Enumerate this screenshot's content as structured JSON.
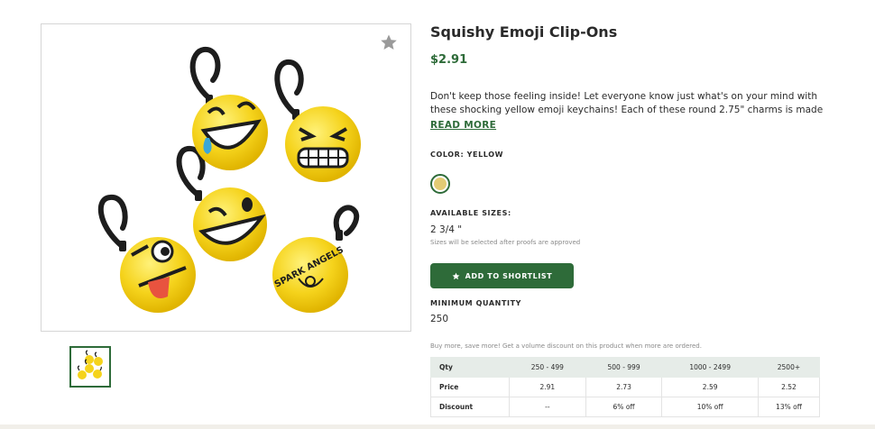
{
  "product": {
    "title": "Squishy Emoji Clip-Ons",
    "price": "$2.91",
    "description": "Don't keep those feeling inside! Let everyone know just what's on your mind with these shocking yellow emoji keychains! Each of these round 2.75\" charms is made o...",
    "read_more": "READ MORE",
    "imprint_text": "SPARK ANGELS"
  },
  "color": {
    "label": "COLOR: YELLOW",
    "swatch_hex": "#e3cb74"
  },
  "sizes": {
    "label": "AVAILABLE SIZES:",
    "value": "2 3/4 \"",
    "note": "Sizes will be selected after proofs are approved"
  },
  "actions": {
    "add_to_shortlist": "ADD TO SHORTLIST",
    "favorite_icon": "star-icon"
  },
  "minimum": {
    "label": "MINIMUM QUANTITY",
    "value": "250"
  },
  "volume_note": "Buy more, save more! Get a volume discount on this product when more are ordered.",
  "pricing_table": {
    "header": [
      "Qty",
      "250 - 499",
      "500 - 999",
      "1000 - 2499",
      "2500+"
    ],
    "rows": [
      [
        "Price",
        "2.91",
        "2.73",
        "2.59",
        "2.52"
      ],
      [
        "Discount",
        "--",
        "6% off",
        "10% off",
        "13% off"
      ]
    ]
  },
  "colors": {
    "brand_green": "#2e6b39",
    "emoji_yellow": "#f5d31c"
  }
}
